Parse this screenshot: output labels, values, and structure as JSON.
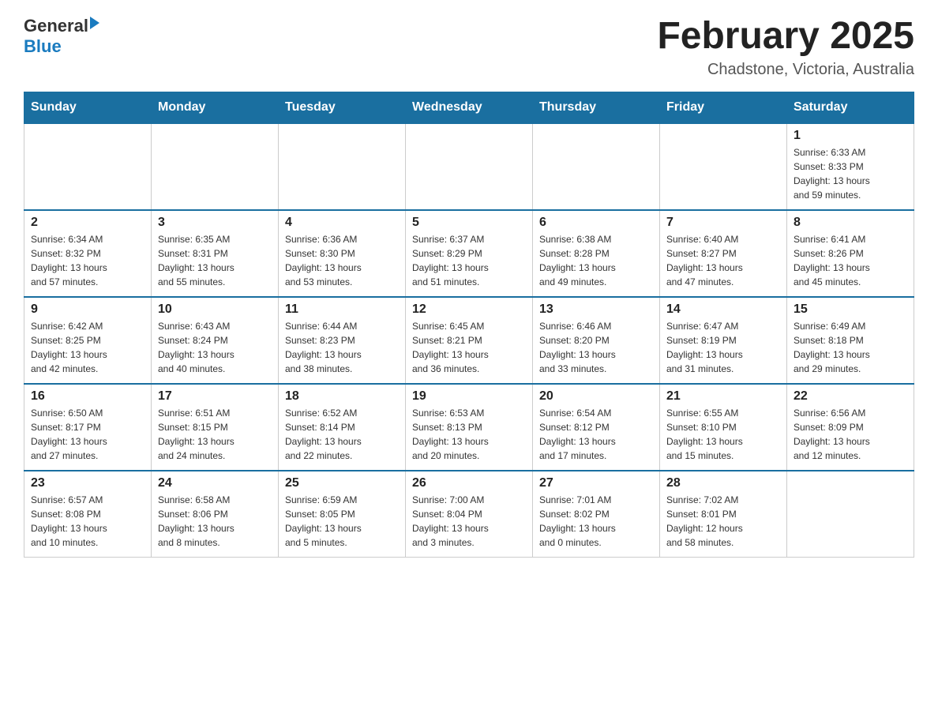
{
  "header": {
    "logo_general": "General",
    "logo_blue": "Blue",
    "month_title": "February 2025",
    "location": "Chadstone, Victoria, Australia"
  },
  "weekdays": [
    "Sunday",
    "Monday",
    "Tuesday",
    "Wednesday",
    "Thursday",
    "Friday",
    "Saturday"
  ],
  "weeks": [
    [
      {
        "day": "",
        "info": ""
      },
      {
        "day": "",
        "info": ""
      },
      {
        "day": "",
        "info": ""
      },
      {
        "day": "",
        "info": ""
      },
      {
        "day": "",
        "info": ""
      },
      {
        "day": "",
        "info": ""
      },
      {
        "day": "1",
        "info": "Sunrise: 6:33 AM\nSunset: 8:33 PM\nDaylight: 13 hours\nand 59 minutes."
      }
    ],
    [
      {
        "day": "2",
        "info": "Sunrise: 6:34 AM\nSunset: 8:32 PM\nDaylight: 13 hours\nand 57 minutes."
      },
      {
        "day": "3",
        "info": "Sunrise: 6:35 AM\nSunset: 8:31 PM\nDaylight: 13 hours\nand 55 minutes."
      },
      {
        "day": "4",
        "info": "Sunrise: 6:36 AM\nSunset: 8:30 PM\nDaylight: 13 hours\nand 53 minutes."
      },
      {
        "day": "5",
        "info": "Sunrise: 6:37 AM\nSunset: 8:29 PM\nDaylight: 13 hours\nand 51 minutes."
      },
      {
        "day": "6",
        "info": "Sunrise: 6:38 AM\nSunset: 8:28 PM\nDaylight: 13 hours\nand 49 minutes."
      },
      {
        "day": "7",
        "info": "Sunrise: 6:40 AM\nSunset: 8:27 PM\nDaylight: 13 hours\nand 47 minutes."
      },
      {
        "day": "8",
        "info": "Sunrise: 6:41 AM\nSunset: 8:26 PM\nDaylight: 13 hours\nand 45 minutes."
      }
    ],
    [
      {
        "day": "9",
        "info": "Sunrise: 6:42 AM\nSunset: 8:25 PM\nDaylight: 13 hours\nand 42 minutes."
      },
      {
        "day": "10",
        "info": "Sunrise: 6:43 AM\nSunset: 8:24 PM\nDaylight: 13 hours\nand 40 minutes."
      },
      {
        "day": "11",
        "info": "Sunrise: 6:44 AM\nSunset: 8:23 PM\nDaylight: 13 hours\nand 38 minutes."
      },
      {
        "day": "12",
        "info": "Sunrise: 6:45 AM\nSunset: 8:21 PM\nDaylight: 13 hours\nand 36 minutes."
      },
      {
        "day": "13",
        "info": "Sunrise: 6:46 AM\nSunset: 8:20 PM\nDaylight: 13 hours\nand 33 minutes."
      },
      {
        "day": "14",
        "info": "Sunrise: 6:47 AM\nSunset: 8:19 PM\nDaylight: 13 hours\nand 31 minutes."
      },
      {
        "day": "15",
        "info": "Sunrise: 6:49 AM\nSunset: 8:18 PM\nDaylight: 13 hours\nand 29 minutes."
      }
    ],
    [
      {
        "day": "16",
        "info": "Sunrise: 6:50 AM\nSunset: 8:17 PM\nDaylight: 13 hours\nand 27 minutes."
      },
      {
        "day": "17",
        "info": "Sunrise: 6:51 AM\nSunset: 8:15 PM\nDaylight: 13 hours\nand 24 minutes."
      },
      {
        "day": "18",
        "info": "Sunrise: 6:52 AM\nSunset: 8:14 PM\nDaylight: 13 hours\nand 22 minutes."
      },
      {
        "day": "19",
        "info": "Sunrise: 6:53 AM\nSunset: 8:13 PM\nDaylight: 13 hours\nand 20 minutes."
      },
      {
        "day": "20",
        "info": "Sunrise: 6:54 AM\nSunset: 8:12 PM\nDaylight: 13 hours\nand 17 minutes."
      },
      {
        "day": "21",
        "info": "Sunrise: 6:55 AM\nSunset: 8:10 PM\nDaylight: 13 hours\nand 15 minutes."
      },
      {
        "day": "22",
        "info": "Sunrise: 6:56 AM\nSunset: 8:09 PM\nDaylight: 13 hours\nand 12 minutes."
      }
    ],
    [
      {
        "day": "23",
        "info": "Sunrise: 6:57 AM\nSunset: 8:08 PM\nDaylight: 13 hours\nand 10 minutes."
      },
      {
        "day": "24",
        "info": "Sunrise: 6:58 AM\nSunset: 8:06 PM\nDaylight: 13 hours\nand 8 minutes."
      },
      {
        "day": "25",
        "info": "Sunrise: 6:59 AM\nSunset: 8:05 PM\nDaylight: 13 hours\nand 5 minutes."
      },
      {
        "day": "26",
        "info": "Sunrise: 7:00 AM\nSunset: 8:04 PM\nDaylight: 13 hours\nand 3 minutes."
      },
      {
        "day": "27",
        "info": "Sunrise: 7:01 AM\nSunset: 8:02 PM\nDaylight: 13 hours\nand 0 minutes."
      },
      {
        "day": "28",
        "info": "Sunrise: 7:02 AM\nSunset: 8:01 PM\nDaylight: 12 hours\nand 58 minutes."
      },
      {
        "day": "",
        "info": ""
      }
    ]
  ]
}
